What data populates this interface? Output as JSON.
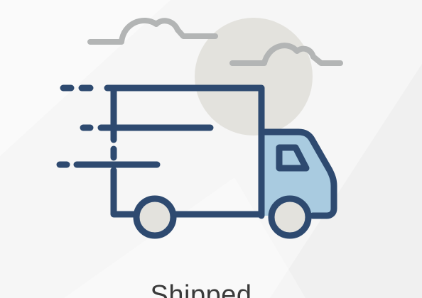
{
  "status": {
    "label": "Shipped",
    "icon": "delivery-truck-icon"
  },
  "colors": {
    "background": "#f6f6f6",
    "truck_outline": "#2e4a70",
    "truck_cab_window": "#a9cbe0",
    "cloud": "#b3b5b5",
    "sun": "#e3e2dd",
    "wheel_fill": "#e3e2dd",
    "label_text": "#3a3a3a"
  }
}
